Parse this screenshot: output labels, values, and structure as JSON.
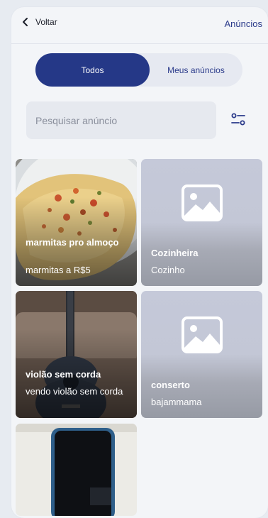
{
  "header": {
    "back_label": "Voltar",
    "ads_label": "Anúncios"
  },
  "tabs": {
    "all_label": "Todos",
    "mine_label": "Meus anúncios"
  },
  "search": {
    "placeholder": "Pesquisar anúncio",
    "value": ""
  },
  "cards": [
    {
      "title": "marmitas pro almoço",
      "subtitle": "marmitas a R$5",
      "has_photo": true,
      "photo": "omelette-photo"
    },
    {
      "title": "Cozinheira",
      "subtitle": "Cozinho",
      "has_photo": false,
      "photo": "image-placeholder-icon"
    },
    {
      "title": "violão sem corda",
      "subtitle": "vendo violão sem corda",
      "has_photo": true,
      "photo": "guitar-photo"
    },
    {
      "title": "conserto",
      "subtitle": "bajammama",
      "has_photo": false,
      "photo": "image-placeholder-icon"
    },
    {
      "title": "",
      "subtitle": "",
      "has_photo": true,
      "photo": "phone-photo"
    }
  ],
  "colors": {
    "accent": "#253887",
    "link": "#2a3a8a",
    "background": "#f3f5f8"
  }
}
